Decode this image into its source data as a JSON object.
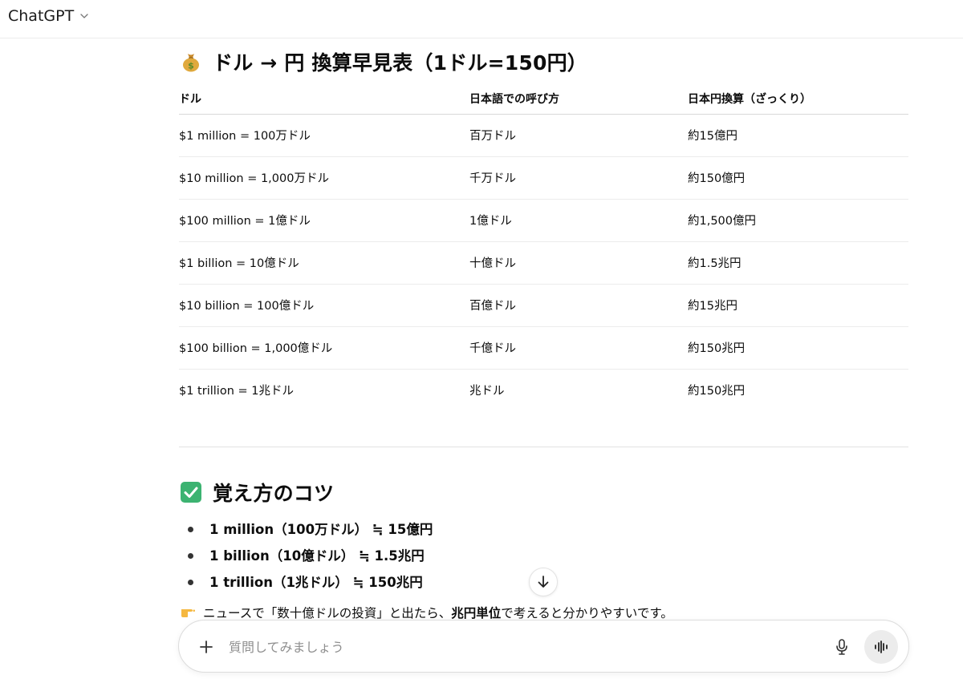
{
  "app": {
    "model_name": "ChatGPT",
    "chevron_icon": "chevron-down-icon"
  },
  "conversion_section": {
    "emoji": "money-bag-icon",
    "title": "ドル → 円 換算早見表（1ドル=150円）",
    "table": {
      "headers": [
        "ドル",
        "日本語での呼び方",
        "日本円換算（ざっくり）"
      ],
      "rows": [
        [
          "$1 million = 100万ドル",
          "百万ドル",
          "約15億円"
        ],
        [
          "$10 million = 1,000万ドル",
          "千万ドル",
          "約150億円"
        ],
        [
          "$100 million = 1億ドル",
          "1億ドル",
          "約1,500億円"
        ],
        [
          "$1 billion = 10億ドル",
          "十億ドル",
          "約1.5兆円"
        ],
        [
          "$10 billion = 100億ドル",
          "百億ドル",
          "約15兆円"
        ],
        [
          "$100 billion = 1,000億ドル",
          "千億ドル",
          "約150兆円"
        ],
        [
          "$1 trillion = 1兆ドル",
          "兆ドル",
          "約150兆円"
        ]
      ]
    }
  },
  "tips_section": {
    "emoji": "check-mark-button-icon",
    "title": "覚え方のコツ",
    "bullets": [
      "1 million（100万ドル） ≒ 15億円",
      "1 billion（10億ドル） ≒ 1.5兆円",
      "1 trillion（1兆ドル） ≒ 150兆円"
    ],
    "note": {
      "emoji": "pointing-hand-icon",
      "before": "ニュースで「数十億ドルの投資」と出たら、",
      "bold": "兆円単位",
      "after": "で考えると分かりやすいです。"
    }
  },
  "composer": {
    "placeholder": "質問してみましょう",
    "value": "",
    "plus_icon": "plus-icon",
    "mic_icon": "microphone-icon",
    "voice_icon": "voice-mode-icon"
  },
  "scroll_button": {
    "icon": "arrow-down-icon"
  },
  "colors": {
    "check_green": "#3cb371",
    "money_bag": "#d9a23a",
    "text": "#0d0d0d",
    "placeholder": "#8f8f8f"
  }
}
